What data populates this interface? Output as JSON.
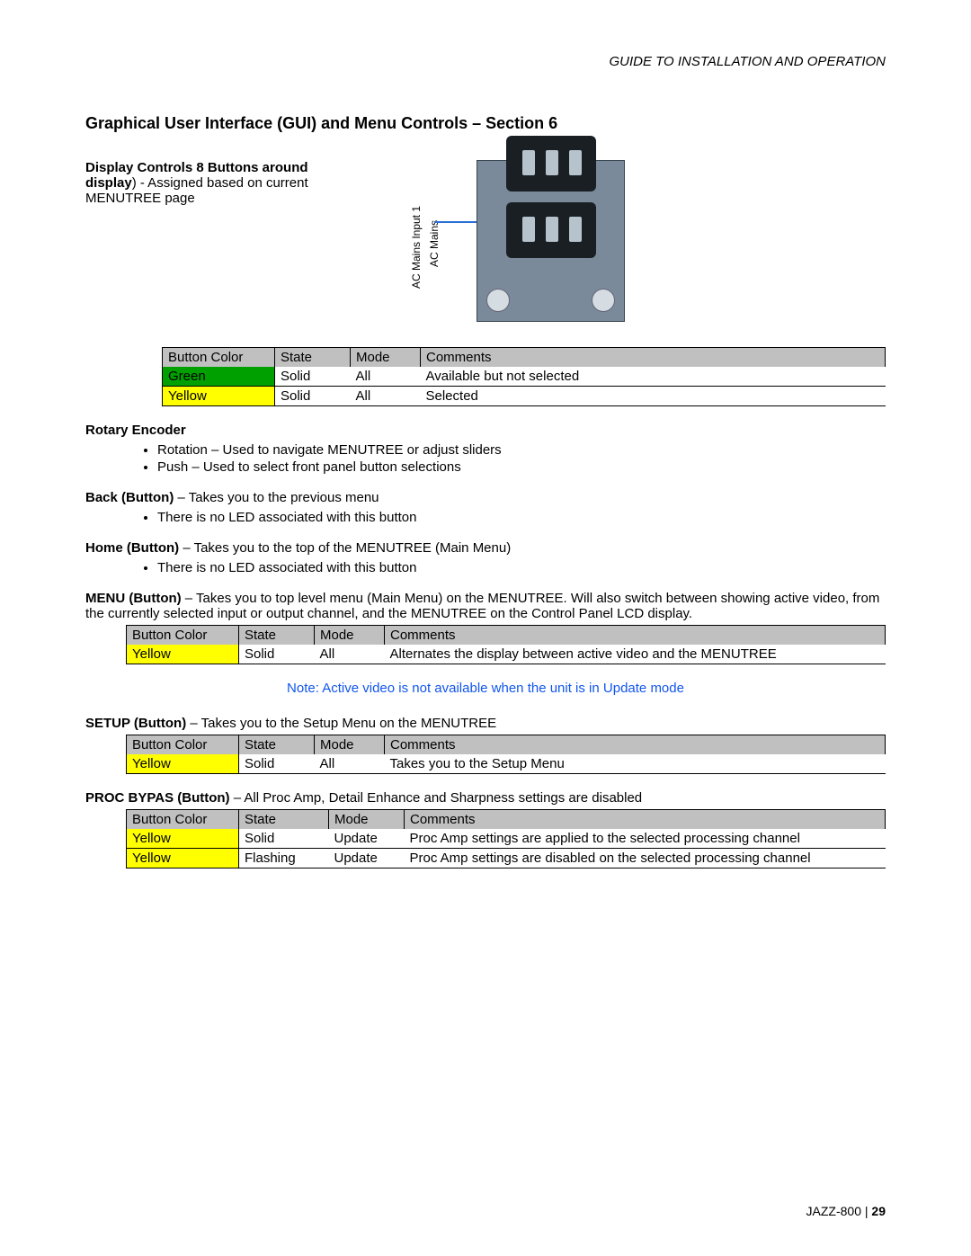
{
  "header": "GUIDE TO INSTALLATION AND OPERATION",
  "title": "Graphical User Interface (GUI) and Menu Controls – Section 6",
  "intro": {
    "bold": "Display Controls 8 Buttons around display",
    "rest": ") - Assigned based on current MENUTREE page"
  },
  "fig_labels": {
    "l1": "AC Mains Input 1",
    "l2": "AC Mains"
  },
  "table1": {
    "headers": [
      "Button Color",
      "State",
      "Mode",
      "Comments"
    ],
    "rows": [
      {
        "color": "Green",
        "cls": "c-green",
        "state": "Solid",
        "mode": "All",
        "comment": "Available but not selected"
      },
      {
        "color": "Yellow",
        "cls": "c-yellow",
        "state": "Solid",
        "mode": "All",
        "comment": "Selected"
      }
    ]
  },
  "rotary": {
    "label": "Rotary Encoder",
    "items": [
      "Rotation – Used to navigate MENUTREE or adjust sliders",
      "Push – Used to select front panel button selections"
    ]
  },
  "back": {
    "bold": "Back (Button)",
    "rest": " – Takes you to the previous menu",
    "items": [
      "There is no LED associated with this button"
    ]
  },
  "home": {
    "bold": "Home (Button)",
    "rest": " – Takes you to the top of the MENUTREE (Main Menu)",
    "items": [
      "There is no LED associated with this button"
    ]
  },
  "menu": {
    "bold": "MENU (Button)",
    "rest": " – Takes you to top level menu (Main Menu) on the MENUTREE. Will also switch between showing active video, from the currently selected input or output channel, and the MENUTREE on the Control Panel LCD display."
  },
  "table2": {
    "headers": [
      "Button Color",
      "State",
      "Mode",
      "Comments"
    ],
    "rows": [
      {
        "color": "Yellow",
        "cls": "c-yellow",
        "state": "Solid",
        "mode": "All",
        "comment": "Alternates the display between active video and the MENUTREE"
      }
    ]
  },
  "note": "Note: Active video is not available when the unit is in Update mode",
  "setup": {
    "bold": "SETUP (Button)",
    "rest": " – Takes you to the Setup Menu on the MENUTREE"
  },
  "table3": {
    "headers": [
      "Button Color",
      "State",
      "Mode",
      "Comments"
    ],
    "rows": [
      {
        "color": "Yellow",
        "cls": "c-yellow",
        "state": "Solid",
        "mode": "All",
        "comment": "Takes you to the Setup Menu"
      }
    ]
  },
  "proc": {
    "bold": "PROC BYPAS (Button)",
    "rest": " – All Proc Amp, Detail Enhance and Sharpness settings are disabled"
  },
  "table4": {
    "headers": [
      "Button Color",
      "State",
      "Mode",
      "Comments"
    ],
    "rows": [
      {
        "color": "Yellow",
        "cls": "c-yellow",
        "state": "Solid",
        "mode": "Update",
        "comment": "Proc Amp settings are applied to the selected processing channel"
      },
      {
        "color": "Yellow",
        "cls": "c-yellow",
        "state": "Flashing",
        "mode": "Update",
        "comment": "Proc Amp settings are disabled on the selected processing channel"
      }
    ]
  },
  "footer": {
    "model": "JAZZ-800",
    "sep": "  |  ",
    "page": "29"
  }
}
